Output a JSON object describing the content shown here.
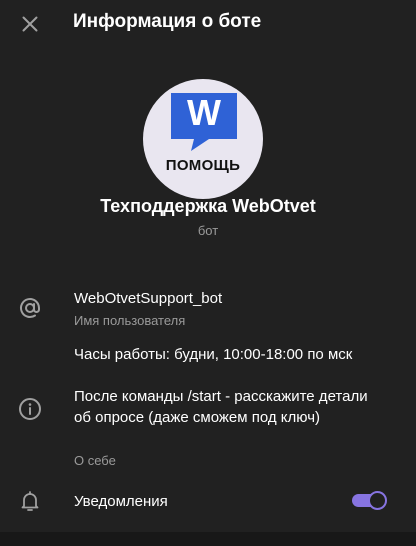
{
  "header": {
    "title": "Информация о боте"
  },
  "avatar": {
    "logo_letter": "W",
    "caption": "ПОМОЩЬ"
  },
  "profile": {
    "name": "Техподдержка WebOtvet",
    "subtitle": "бот"
  },
  "info": {
    "username": "WebOtvetSupport_bot",
    "username_label": "Имя пользователя",
    "hours": "Часы работы: будни, 10:00-18:00 по мск",
    "about": "После команды /start - расскажите детали об опросе (даже сможем под ключ)",
    "about_label": "О себе"
  },
  "notifications": {
    "label": "Уведомления",
    "enabled": true
  },
  "colors": {
    "accent": "#8774e1",
    "logo_blue": "#2f62d6"
  }
}
